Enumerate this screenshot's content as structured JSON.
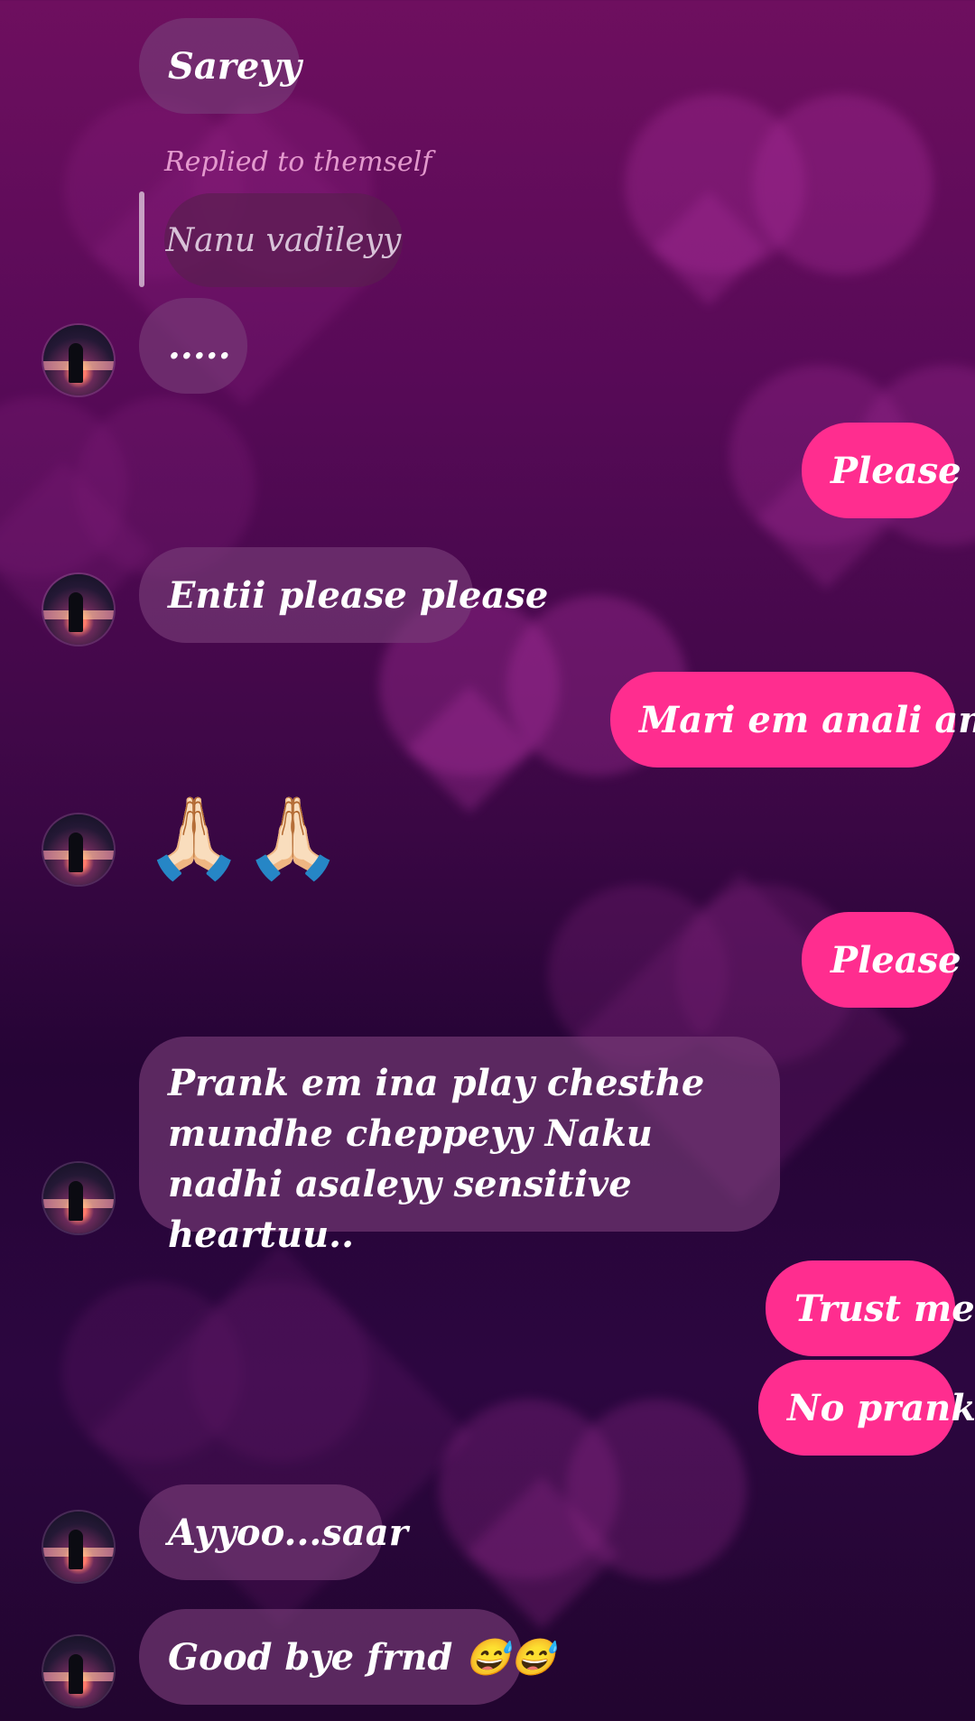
{
  "conversation": {
    "reply_context": {
      "label": "Replied to themself",
      "quoted_text": "Nanu vadileyy"
    },
    "messages": [
      {
        "from": "them",
        "text": "Sareyy"
      },
      {
        "from": "them",
        "text": "....."
      },
      {
        "from": "me",
        "text": "Please"
      },
      {
        "from": "them",
        "text": "Entii please please"
      },
      {
        "from": "me",
        "text": "Mari em anali andi"
      },
      {
        "from": "them",
        "text": "🙏🏻🙏🏻"
      },
      {
        "from": "me",
        "text": "Please"
      },
      {
        "from": "them",
        "text": "Prank em ina play chesthe mundhe cheppeyy Naku nadhi asaleyy sensitive heartuu.."
      },
      {
        "from": "me",
        "text": "Trust me"
      },
      {
        "from": "me",
        "text": "No prank"
      },
      {
        "from": "them",
        "text": "Ayyoo...saar"
      },
      {
        "from": "them",
        "text": "Good bye frnd 😅😅"
      }
    ]
  },
  "colors": {
    "incoming_bubble": "#783c78",
    "outgoing_bubble": "#ff2d8f",
    "background_top": "#6e0f5f",
    "background_bottom": "#22052f"
  },
  "icons": {
    "avatar": "contact-avatar"
  }
}
